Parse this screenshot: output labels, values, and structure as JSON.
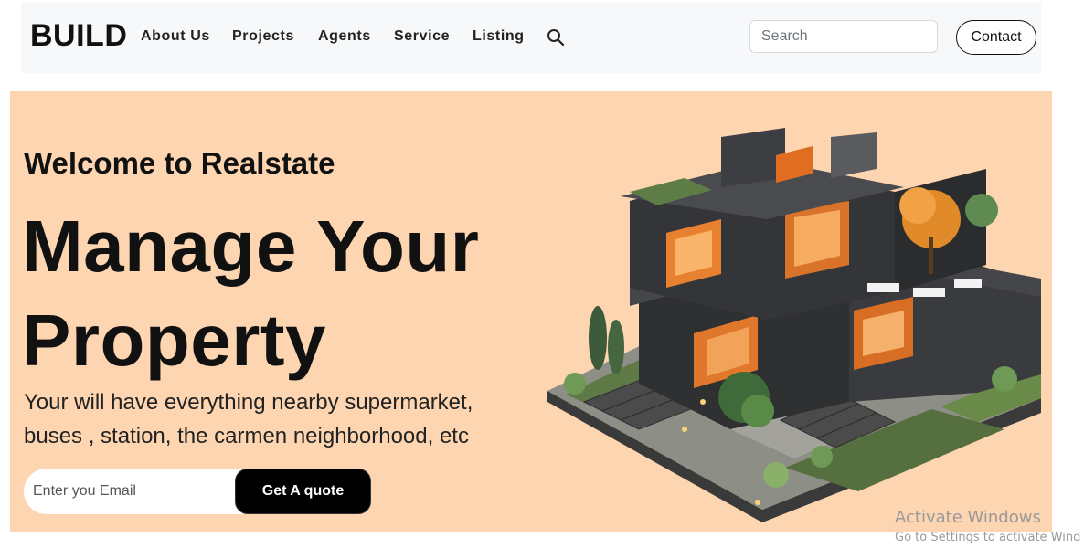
{
  "navbar": {
    "brand": "BUILD",
    "links": [
      "About Us",
      "Projects",
      "Agents",
      "Service",
      "Listing"
    ],
    "search_icon": "search-icon",
    "search_placeholder": "Search",
    "contact_label": "Contact"
  },
  "hero": {
    "welcome": "Welcome to Realstate",
    "headline_line1": "Manage Your",
    "headline_line2": "Property",
    "subtext_line1": "Your will have everything nearby supermarket,",
    "subtext_line2": "buses , station, the carmen neighborhood, etc",
    "email_placeholder": "Enter you Email",
    "quote_label": "Get A quote",
    "background_color": "#fdd5b1"
  },
  "watermark": {
    "title": "Activate Windows",
    "subtitle": "Go to Settings to activate Wind"
  }
}
